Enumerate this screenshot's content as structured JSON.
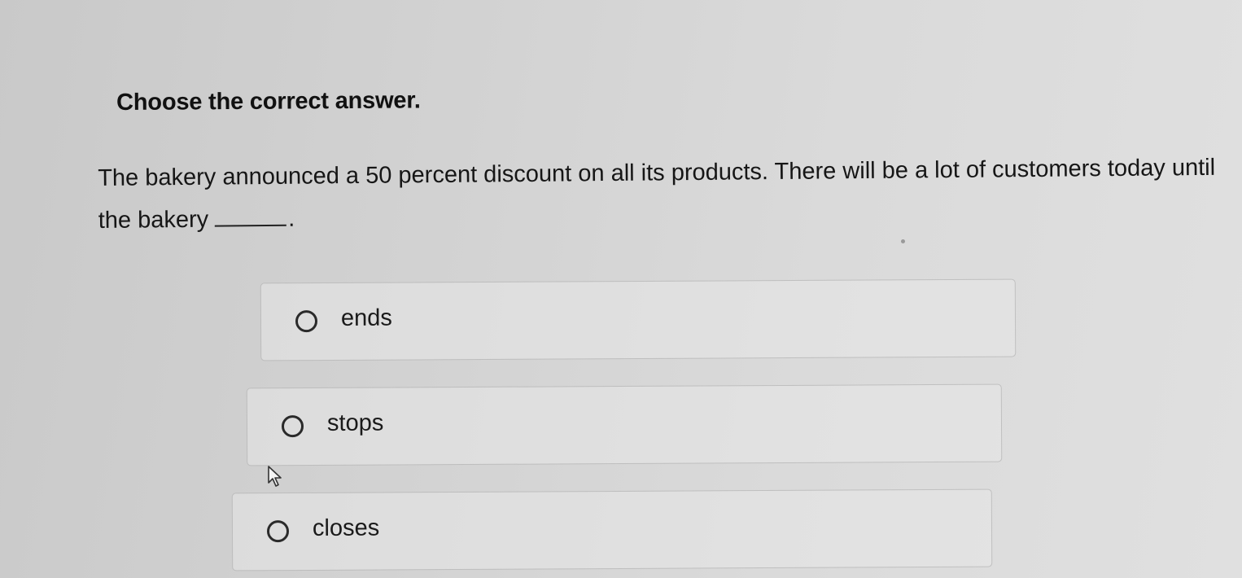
{
  "quiz": {
    "instruction": "Choose the correct answer.",
    "question_part1": "The bakery announced a 50 percent discount on all its products. There will be a lot of customers today until the bakery",
    "question_end": ".",
    "options": [
      {
        "label": "ends",
        "selected": false
      },
      {
        "label": "stops",
        "selected": false
      },
      {
        "label": "closes",
        "selected": false
      }
    ]
  },
  "icons": {
    "radio": "radio-empty-icon",
    "cursor": "mouse-pointer-icon"
  },
  "colors": {
    "text": "#1a1a1a",
    "option_border": "#969696"
  }
}
